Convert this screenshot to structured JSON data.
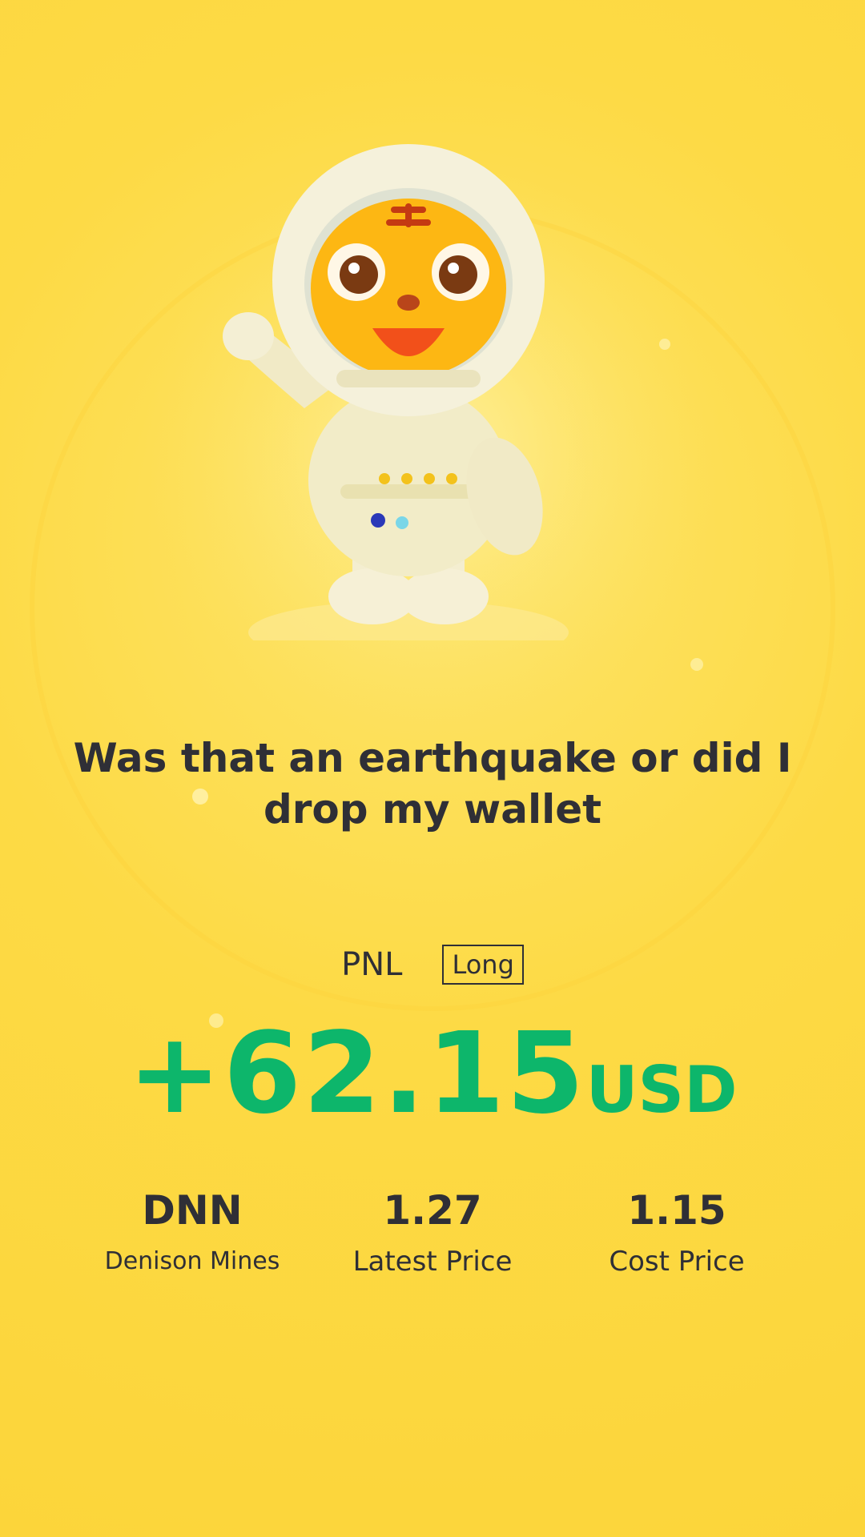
{
  "headline": "Was that an earthquake or did I drop my wallet",
  "pnl": {
    "label": "PNL",
    "side": "Long",
    "value": "+62.15",
    "unit": "USD",
    "value_color": "#0db66b"
  },
  "stats": [
    {
      "value": "DNN",
      "label": "Denison Mines"
    },
    {
      "value": "1.27",
      "label": "Latest Price"
    },
    {
      "value": "1.15",
      "label": "Cost Price"
    }
  ],
  "mascot": {
    "icon": "tiger-astronaut-mascot"
  },
  "colors": {
    "background": "#fdda45",
    "text": "#2f2f36",
    "profit": "#0db66b"
  }
}
